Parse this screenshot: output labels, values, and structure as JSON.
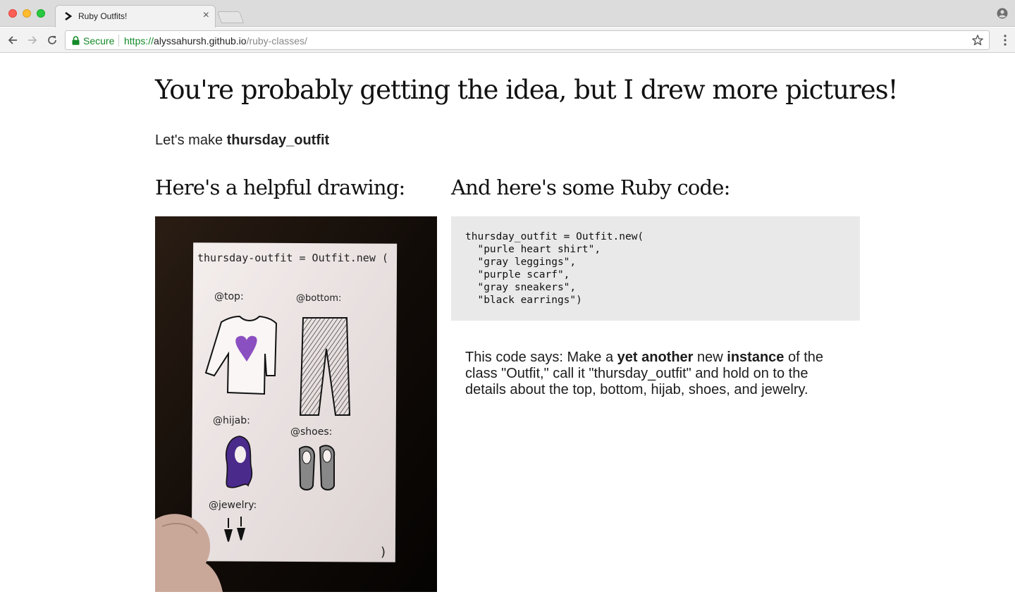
{
  "browser": {
    "tab_title": "Ruby Outfits!",
    "tab_close": "×",
    "secure_label": "Secure",
    "url_scheme": "https://",
    "url_host": "alyssahursh.github.io",
    "url_path": "/ruby-classes/"
  },
  "page": {
    "heading": "You're probably getting the idea, but I drew more pictures!",
    "intro_prefix": "Let's make ",
    "intro_var": "thursday_outfit",
    "drawing_heading": "Here's a helpful drawing:",
    "code_heading": "And here's some Ruby code:",
    "code_lines": [
      "thursday_outfit = Outfit.new(",
      "  \"purle heart shirt\",",
      "  \"gray leggings\",",
      "  \"purple scarf\",",
      "  \"gray sneakers\",",
      "  \"black earrings\")"
    ],
    "explain": {
      "p1": "This code says: Make a ",
      "b1": "yet another",
      "p2": " new ",
      "b2": "instance",
      "p3": " of the class \"Outfit,\" call it \"thursday_outfit\" and hold on to the details about the top, bottom, hijab, shoes, and jewelry."
    }
  },
  "drawing": {
    "card_title": "thursday-outfit = Outfit.new (",
    "labels": [
      "@top:",
      "@bottom:",
      "@hijab:",
      "@shoes:",
      "@jewelry:"
    ],
    "closing_paren": ")"
  },
  "colors": {
    "secure_green": "#138a28",
    "code_bg": "#e9e9e9",
    "heart_purple": "#8a4fc0",
    "scarf_purple": "#4a2a8a"
  }
}
